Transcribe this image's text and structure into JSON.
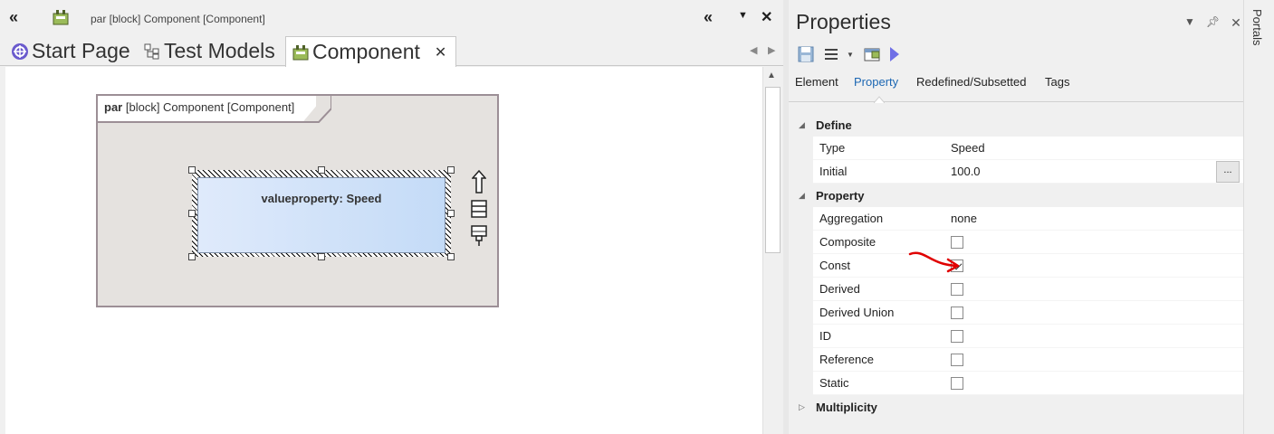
{
  "left_window": {
    "title": "par [block] Component [Component]",
    "tabs": [
      {
        "label": "Start Page",
        "icon": "start-page-icon"
      },
      {
        "label": "Test Models",
        "icon": "model-tree-icon"
      },
      {
        "label": "Component",
        "icon": "diagram-icon",
        "active": true
      }
    ]
  },
  "diagram": {
    "frame_keyword": "par",
    "frame_rest": "[block] Component [Component]",
    "property_label": "valueproperty: Speed",
    "quick_tools": [
      "arrow-up-icon",
      "list-icon",
      "pin-icon"
    ]
  },
  "properties": {
    "title": "Properties",
    "tabs": [
      "Element",
      "Property",
      "Redefined/Subsetted",
      "Tags"
    ],
    "active_tab": "Property",
    "sections": [
      {
        "name": "Define",
        "expanded": true,
        "rows": [
          {
            "key": "Type",
            "value": "Speed"
          },
          {
            "key": "Initial",
            "value": "100.0",
            "has_button": true,
            "button_label": "..."
          }
        ]
      },
      {
        "name": "Property",
        "expanded": true,
        "rows": [
          {
            "key": "Aggregation",
            "value": "none"
          },
          {
            "key": "Composite",
            "checkbox": false
          },
          {
            "key": "Const",
            "checkbox": true
          },
          {
            "key": "Derived",
            "checkbox": false
          },
          {
            "key": "Derived Union",
            "checkbox": false
          },
          {
            "key": "ID",
            "checkbox": false
          },
          {
            "key": "Reference",
            "checkbox": false
          },
          {
            "key": "Static",
            "checkbox": false
          }
        ]
      },
      {
        "name": "Multiplicity",
        "expanded": false,
        "rows": []
      }
    ]
  },
  "portals": {
    "label": "Portals"
  },
  "colors": {
    "accent": "#1c67b3",
    "annotation": "#e00000",
    "frame_bg": "#e5e2df"
  }
}
